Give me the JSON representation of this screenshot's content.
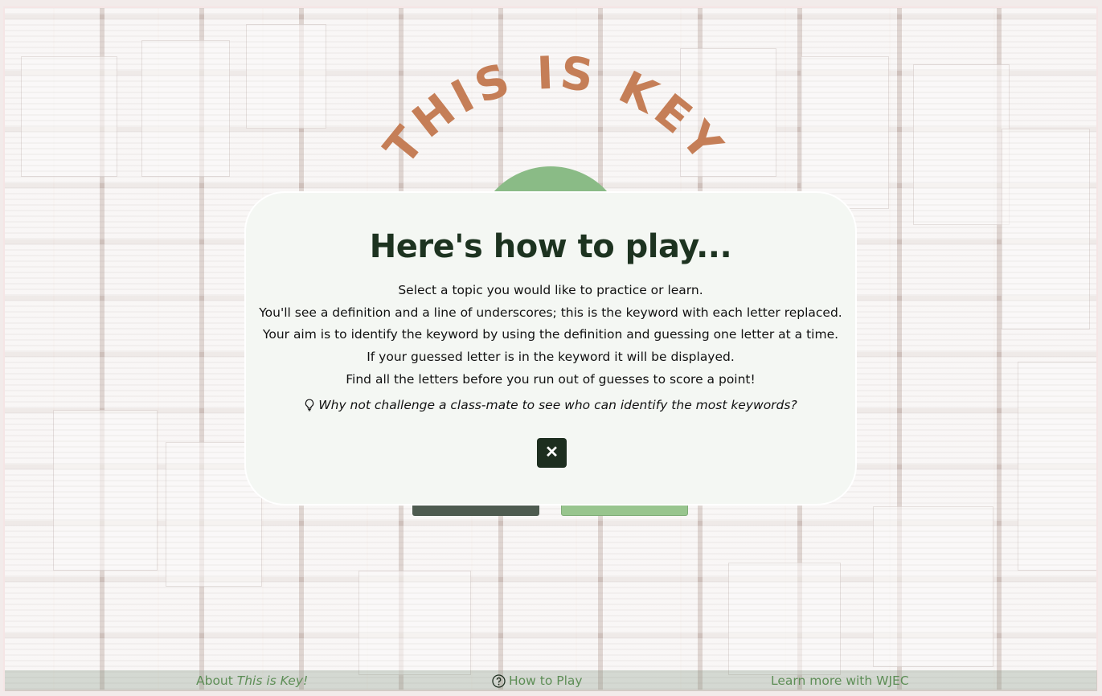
{
  "app": {
    "arc_title": "THIS IS KEY"
  },
  "modal": {
    "heading": "Here's how to play...",
    "lines": [
      "Select a topic you would like to practice or learn.",
      "You'll see a definition and a line of underscores; this is the keyword with each letter replaced.",
      "Your aim is to identify the keyword by using the definition and guessing one letter at a time.",
      "If your guessed letter is in the keyword it will be displayed.",
      "Find all the letters before you run out of guesses to score a point!"
    ],
    "tip": "Why not challenge a class-mate to see who can identify the most keywords?",
    "tip_icon": "lightbulb-icon",
    "close_icon": "close-icon",
    "close_glyph": "✕"
  },
  "footer": {
    "about_prefix": "About ",
    "about_em": "This is Key!",
    "how_to_play": "How to Play",
    "how_icon": "question-circle-icon",
    "wjec": "Learn more with WJEC"
  },
  "colors": {
    "accent_dark": "#1d2e1f",
    "accent_green": "#6aa864",
    "title_orange": "#b55a28",
    "footer_text": "#5d8e56"
  }
}
